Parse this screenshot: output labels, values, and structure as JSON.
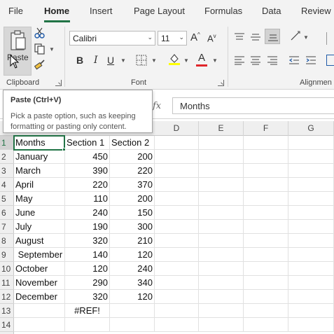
{
  "tabs": [
    "File",
    "Home",
    "Insert",
    "Page Layout",
    "Formulas",
    "Data",
    "Review"
  ],
  "ribbon": {
    "paste_label": "Paste",
    "font_name": "Calibri",
    "font_size": "11",
    "bold": "B",
    "italic": "I",
    "underline": "U",
    "grow_font": "A",
    "shrink_font": "A",
    "font_color_glyph": "A",
    "groups": {
      "clipboard": "Clipboard",
      "font": "Font",
      "alignment": "Alignmen"
    },
    "accent_colors": {
      "highlight": "#ffff00",
      "font_color": "#e0262b",
      "brand": "#217346"
    }
  },
  "tooltip": {
    "title": "Paste (Ctrl+V)",
    "body": "Pick a paste option, such as keeping formatting or pasting only content."
  },
  "formula_bar": {
    "fx": "fx",
    "value": "Months"
  },
  "columns": [
    "D",
    "E",
    "F",
    "G"
  ],
  "rows": [
    "1",
    "2",
    "3",
    "4",
    "5",
    "6",
    "7",
    "8",
    "9",
    "10",
    "11",
    "12",
    "13",
    "14"
  ],
  "table": {
    "rows": [
      [
        "Months",
        "Section 1",
        "Section 2"
      ],
      [
        "January",
        "450",
        "200"
      ],
      [
        "March",
        "390",
        "220"
      ],
      [
        "April",
        "220",
        "370"
      ],
      [
        "May",
        "110",
        "200"
      ],
      [
        "June",
        "240",
        "150"
      ],
      [
        "July",
        "190",
        "300"
      ],
      [
        "August",
        "320",
        "210"
      ],
      [
        " September",
        "140",
        "120"
      ],
      [
        "October",
        "120",
        "240"
      ],
      [
        "November",
        "290",
        "340"
      ],
      [
        "December",
        "320",
        "120"
      ],
      [
        "",
        "#REF!",
        ""
      ]
    ]
  }
}
